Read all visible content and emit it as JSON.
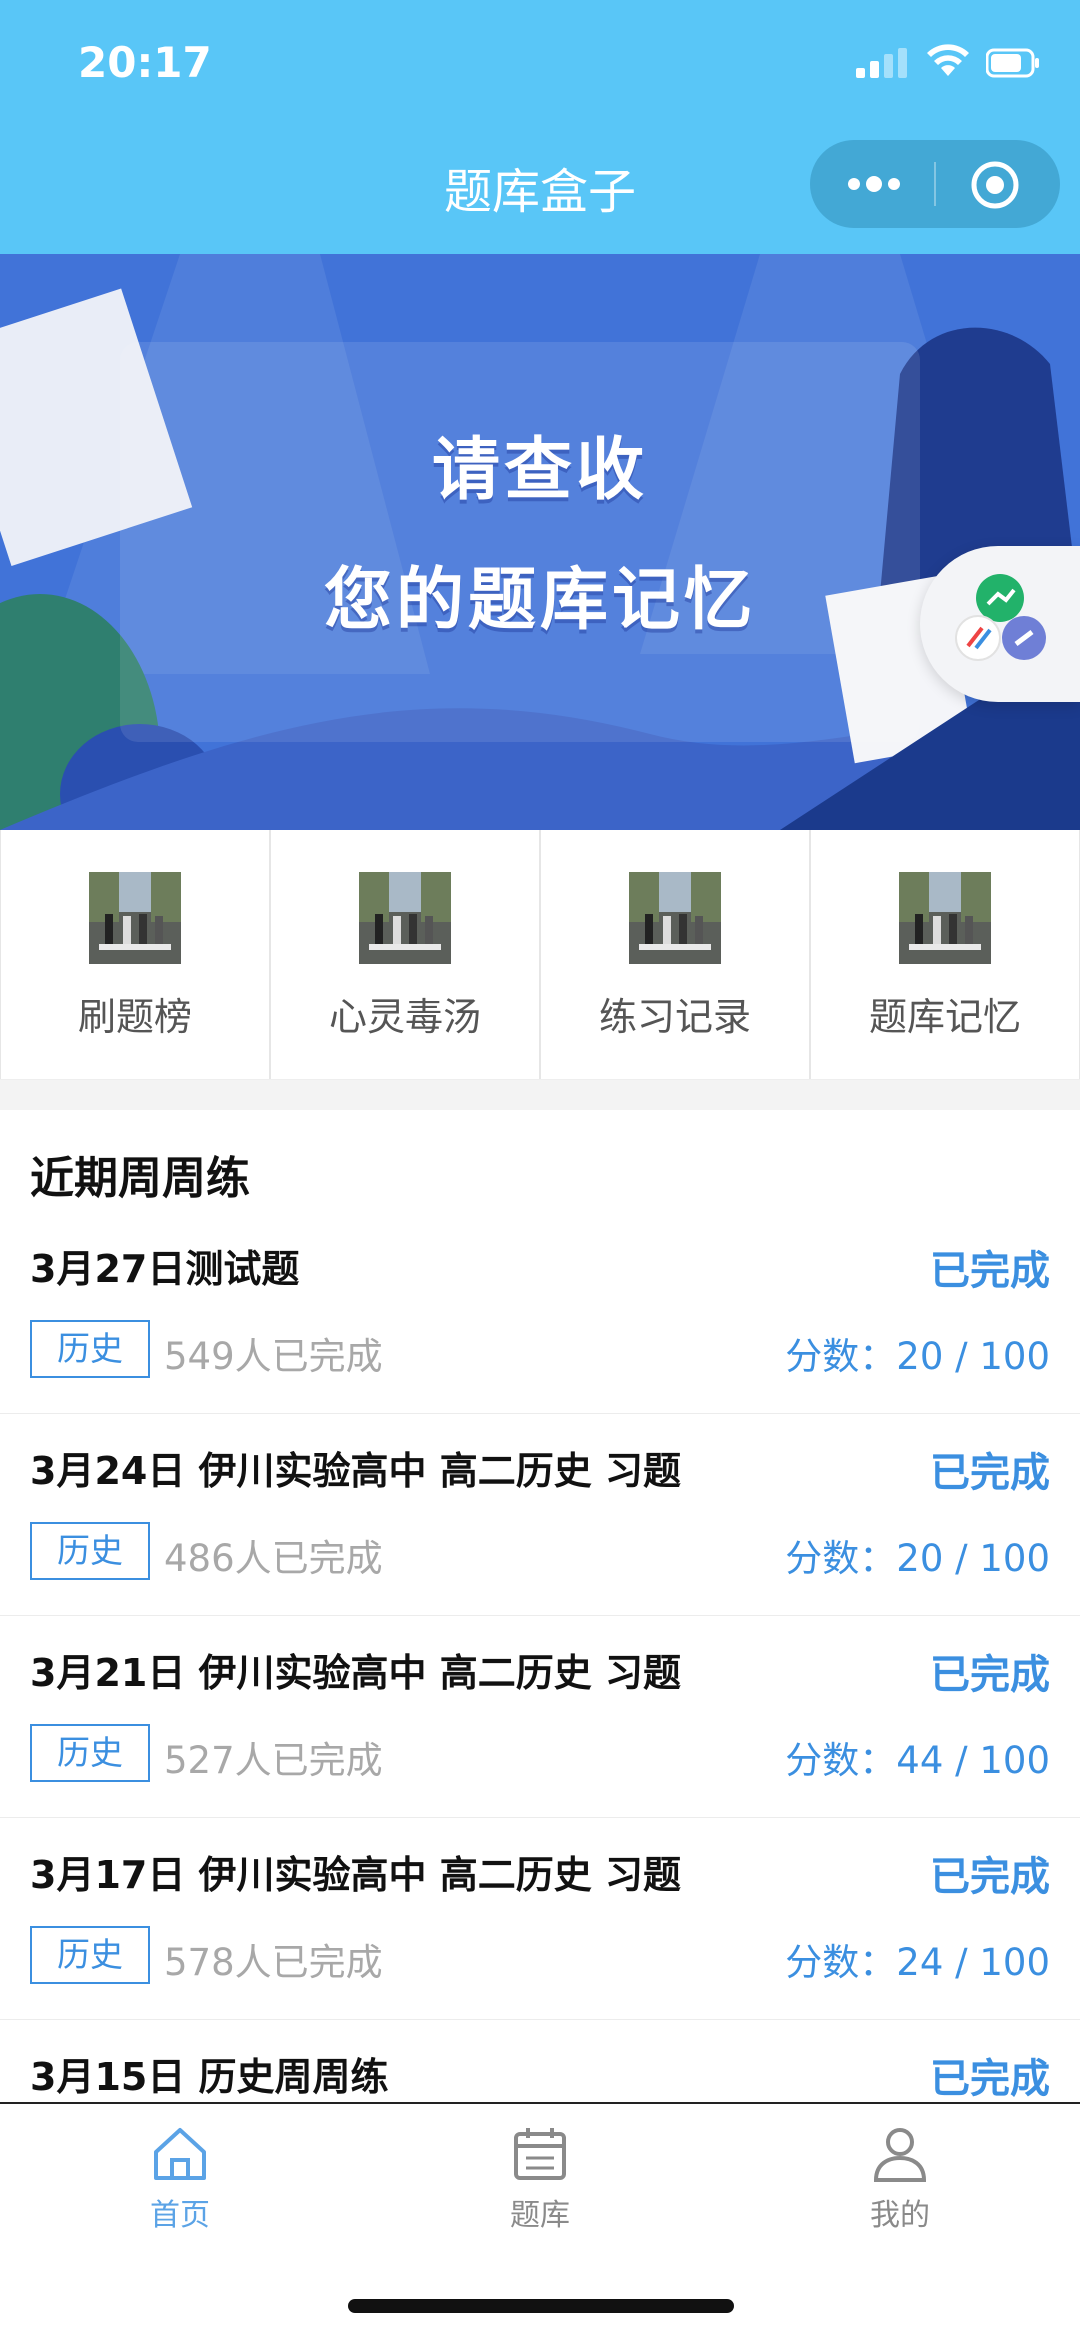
{
  "status_bar": {
    "time": "20:17"
  },
  "navbar": {
    "title": "题库盒子"
  },
  "banner": {
    "line1": "请查收",
    "line2": "您的题库记忆"
  },
  "grid": [
    {
      "label": "刷题榜"
    },
    {
      "label": "心灵毒汤"
    },
    {
      "label": "练习记录"
    },
    {
      "label": "题库记忆"
    }
  ],
  "section": {
    "title": "近期周周练"
  },
  "list": [
    {
      "title": "3月27日测试题",
      "status": "已完成",
      "tag": "历史",
      "count": "549人已完成",
      "score": "分数：20 / 100"
    },
    {
      "title": "3月24日 伊川实验高中 高二历史 习题",
      "status": "已完成",
      "tag": "历史",
      "count": "486人已完成",
      "score": "分数：20 / 100"
    },
    {
      "title": "3月21日 伊川实验高中 高二历史 习题",
      "status": "已完成",
      "tag": "历史",
      "count": "527人已完成",
      "score": "分数：44 / 100"
    },
    {
      "title": "3月17日 伊川实验高中 高二历史 习题",
      "status": "已完成",
      "tag": "历史",
      "count": "578人已完成",
      "score": "分数：24 / 100"
    },
    {
      "title": "3月15日 历史周周练",
      "status": "已完成"
    }
  ],
  "tabbar": {
    "home": "首页",
    "bank": "题库",
    "mine": "我的",
    "active_color": "#5ba3e6",
    "inactive_color": "#8a8a8a"
  },
  "colors": {
    "header": "#59c6f7",
    "accent": "#3b8fe0",
    "banner": "#4173d8"
  }
}
